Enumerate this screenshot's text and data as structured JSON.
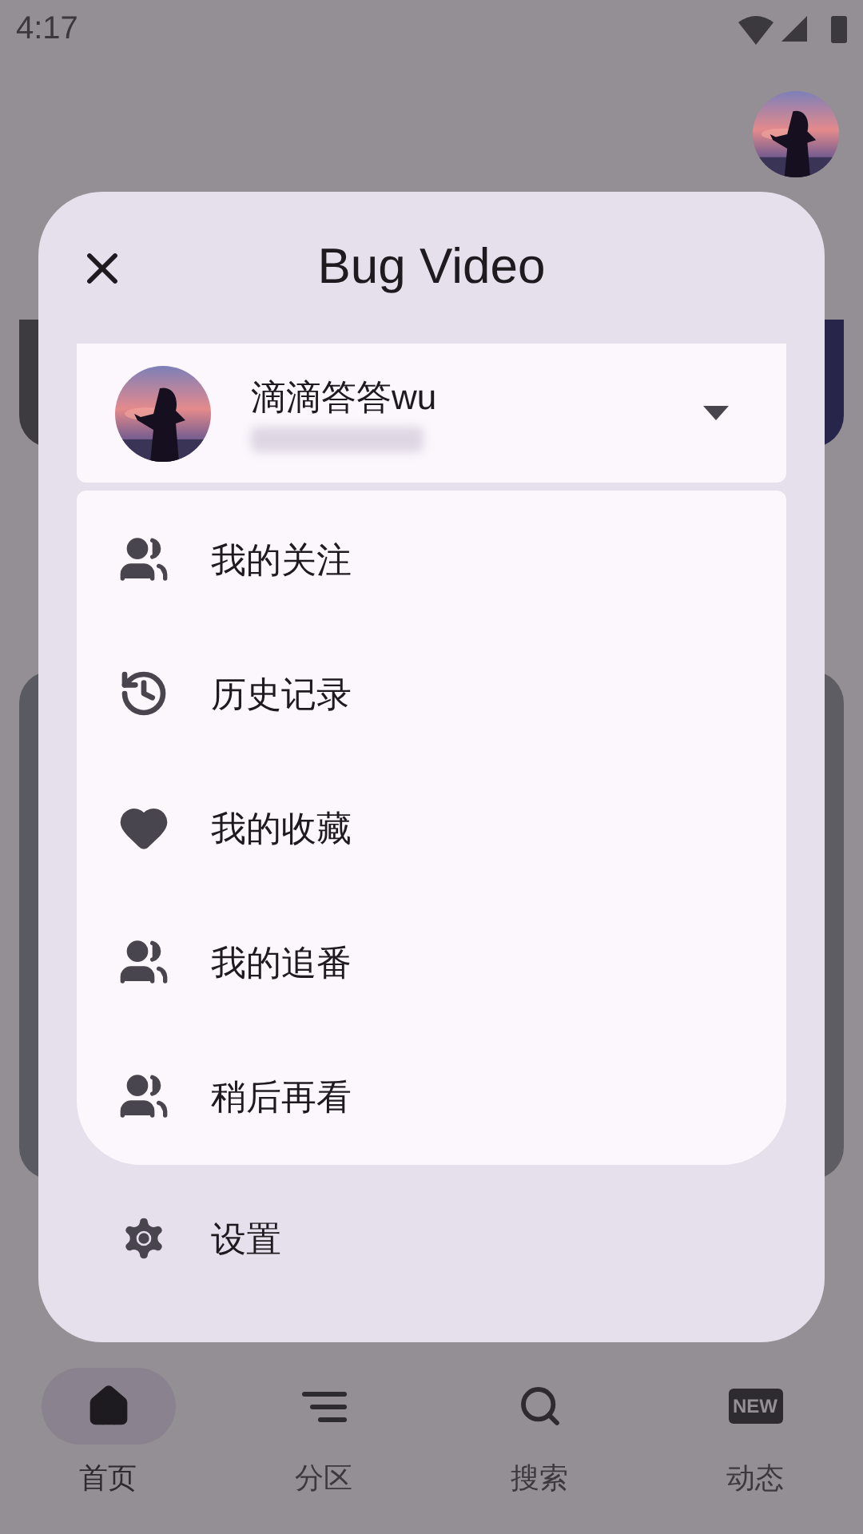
{
  "status_bar": {
    "time": "4:17"
  },
  "dialog": {
    "title": "Bug Video",
    "account": {
      "name": "滴滴答答wu",
      "expanded": false
    },
    "menu": [
      {
        "kind": "people",
        "label": "我的关注"
      },
      {
        "kind": "history",
        "label": "历史记录"
      },
      {
        "kind": "heart",
        "label": "我的收藏"
      },
      {
        "kind": "people",
        "label": "我的追番"
      },
      {
        "kind": "people",
        "label": "稍后再看"
      }
    ],
    "settings": {
      "kind": "gear",
      "label": "设置"
    }
  },
  "bottom_nav": [
    {
      "kind": "home",
      "label": "首页",
      "selected": true
    },
    {
      "kind": "list",
      "label": "分区",
      "selected": false
    },
    {
      "kind": "search",
      "label": "搜索",
      "selected": false
    },
    {
      "kind": "new",
      "label": "动态",
      "selected": false,
      "badge": "NEW"
    }
  ]
}
